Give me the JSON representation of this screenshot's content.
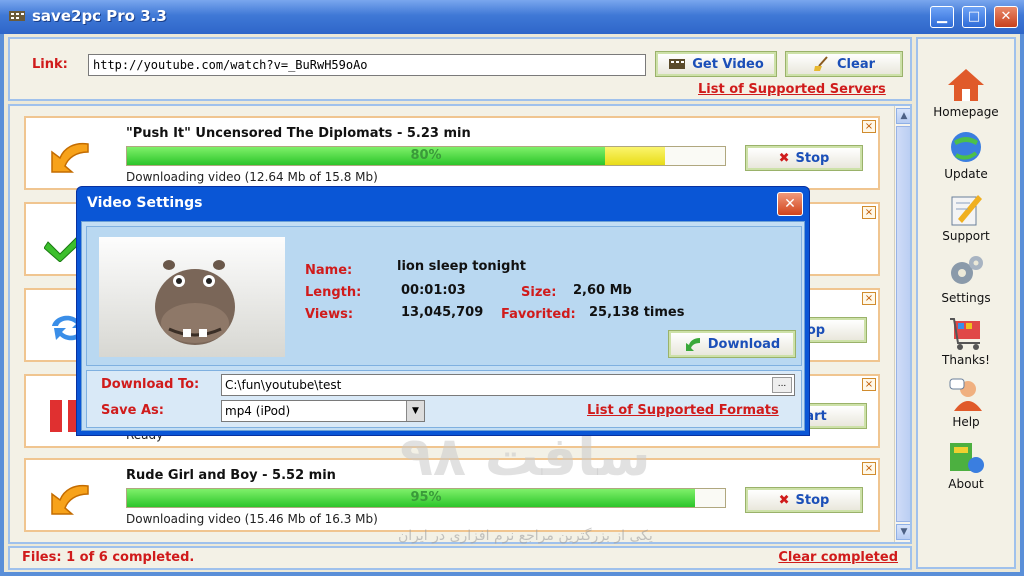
{
  "window": {
    "title": "save2pc Pro  3.3"
  },
  "toolbar": {
    "link_label": "Link:",
    "link_value": "http://youtube.com/watch?v=_BuRwH59oAo",
    "get_video_label": "Get Video",
    "clear_label": "Clear",
    "servers_link": "List of Supported Servers"
  },
  "downloads": [
    {
      "title": "\"Push It\" Uncensored The Diplomats - 5.23 min",
      "progress_label": "80%",
      "progress": 0.8,
      "buffer": 0.1,
      "status": "Downloading video (12.64 Mb of 15.8 Mb)",
      "action": "Stop"
    },
    {
      "title": "",
      "status": "",
      "action": ""
    },
    {
      "title": "",
      "status": "",
      "action": "op"
    },
    {
      "title": "",
      "status": "Ready",
      "action": "art"
    },
    {
      "title": "Rude Girl and Boy - 5.52 min",
      "progress_label": "95%",
      "progress": 0.95,
      "status": "Downloading video (15.46 Mb of 16.3 Mb)",
      "action": "Stop"
    }
  ],
  "footer": {
    "files": "Files: 1 of 6 completed.",
    "clear_completed": "Clear completed"
  },
  "sidebar": [
    {
      "label": "Homepage",
      "icon": "house-icon"
    },
    {
      "label": "Update",
      "icon": "globe-update-icon"
    },
    {
      "label": "Support",
      "icon": "support-icon"
    },
    {
      "label": "Settings",
      "icon": "gears-icon"
    },
    {
      "label": "Thanks!",
      "icon": "cart-icon"
    },
    {
      "label": "Help",
      "icon": "help-icon"
    },
    {
      "label": "About",
      "icon": "about-icon"
    }
  ],
  "dialog": {
    "title": "Video Settings",
    "name_label": "Name:",
    "name_value": "lion sleep tonight",
    "length_label": "Length:",
    "length_value": "00:01:03",
    "size_label": "Size:",
    "size_value": "2,60 Mb",
    "views_label": "Views:",
    "views_value": "13,045,709",
    "favorited_label": "Favorited:",
    "favorited_value": "25,138 times",
    "download_label": "Download",
    "download_to_label": "Download To:",
    "download_to_value": "C:\\fun\\youtube\\test",
    "browse_label": "...",
    "save_as_label": "Save As:",
    "save_as_value": "mp4 (iPod)",
    "formats_link": "List of Supported Formats"
  },
  "watermark": {
    "text": "سافت ۹۸",
    "sub": "یکی از بزرگترین مراجع نرم افزاری در ایران"
  },
  "colors": {
    "accent_red": "#d01b1b",
    "title_blue": "#0a56d6",
    "progress_green": "#2cc52a",
    "link_blue": "#1b4fb8"
  }
}
